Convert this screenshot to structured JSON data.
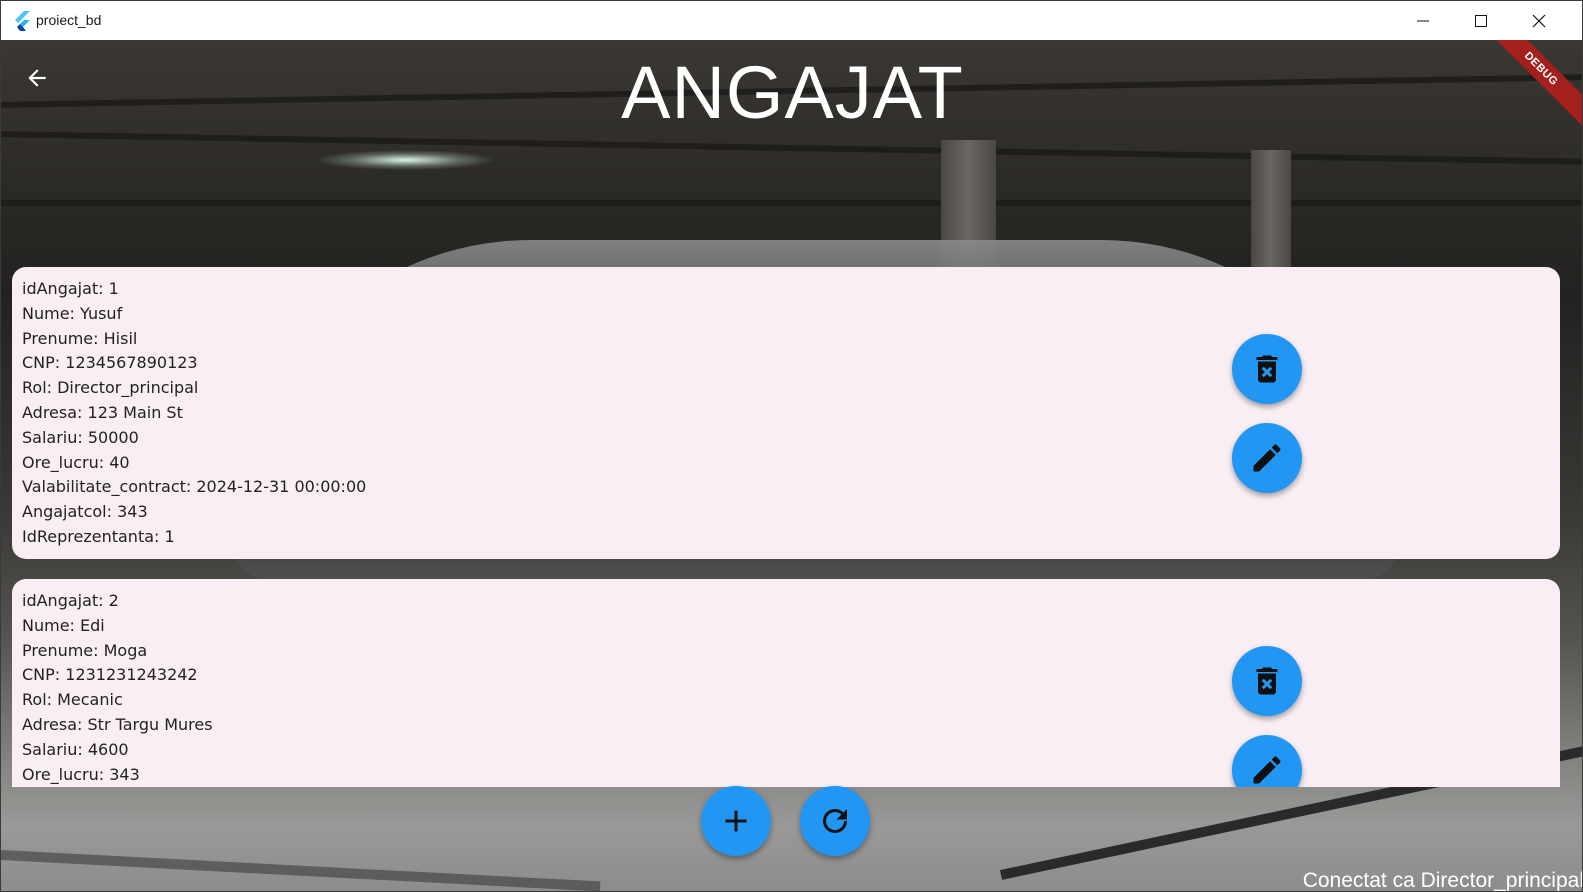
{
  "window": {
    "title": "proiect_bd"
  },
  "header": {
    "title": "ANGAJAT"
  },
  "debug_banner": "DEBUG",
  "employees": [
    {
      "lines": [
        "idAngajat: 1",
        "Nume: Yusuf",
        "Prenume: Hisil",
        "CNP: 1234567890123",
        "Rol: Director_principal",
        "Adresa: 123 Main St",
        "Salariu: 50000",
        "Ore_lucru: 40",
        "Valabilitate_contract: 2024-12-31 00:00:00",
        "Angajatcol: 343",
        "IdReprezentanta: 1"
      ]
    },
    {
      "lines": [
        "idAngajat: 2",
        "Nume: Edi",
        "Prenume: Moga",
        "CNP: 1231231243242",
        "Rol: Mecanic",
        "Adresa: Str Targu Mures",
        "Salariu: 4600",
        "Ore_lucru: 343"
      ]
    }
  ],
  "icons": {
    "delete": "delete-forever-icon",
    "edit": "edit-pencil-icon",
    "add": "add-icon",
    "refresh": "refresh-icon",
    "back": "arrow-back-icon"
  },
  "colors": {
    "fab": "#2196f3",
    "card": "#f8eef4",
    "debug": "#a3201d"
  },
  "status": {
    "text": "Conectat ca Director_principal"
  }
}
